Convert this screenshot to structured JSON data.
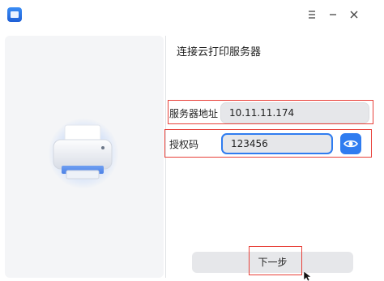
{
  "window": {
    "controls": {
      "menu_icon": "menu-icon",
      "minimize_icon": "minimize-icon",
      "close_icon": "close-icon"
    }
  },
  "page": {
    "title": "连接云打印服务器"
  },
  "form": {
    "server_label": "服务器地址",
    "server_value": "10.11.11.174",
    "auth_label": "授权码",
    "auth_value": "123456"
  },
  "footer": {
    "next_label": "下一步"
  },
  "colors": {
    "accent": "#2f7cf0",
    "highlight": "#e8413a",
    "input_bg": "#e6e7ea",
    "left_panel_bg": "#f4f5f7"
  }
}
